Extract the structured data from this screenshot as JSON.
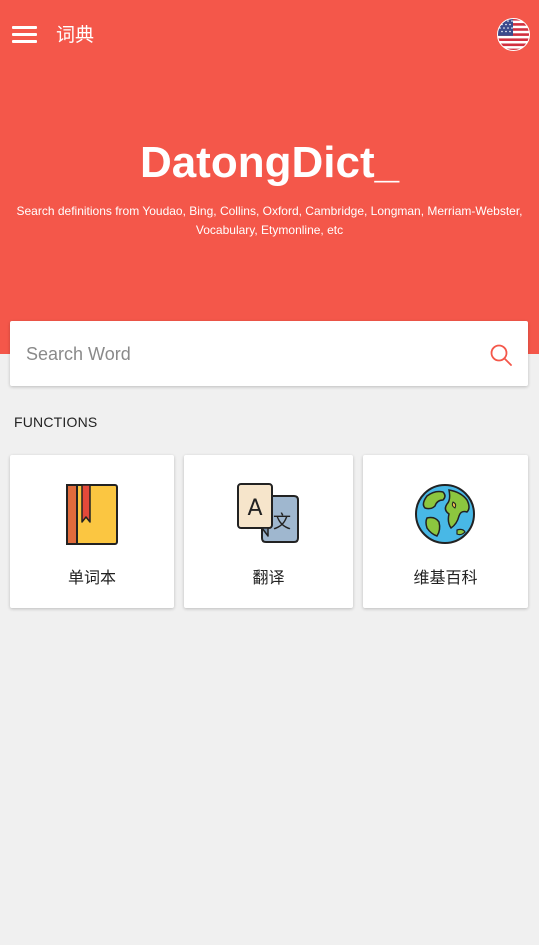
{
  "header": {
    "app_title": "词典",
    "menu_icon": "hamburger-menu-icon",
    "language_flag_icon": "us-flag-icon"
  },
  "hero": {
    "brand": "DatongDict_",
    "tagline_line1": "Search definitions from Youdao, Bing, Collins, Oxford, Cambridge, Longman, Merriam-Webster,",
    "tagline_line2": "Vocabulary, Etymonline, etc",
    "background_color": "#f4574a"
  },
  "search": {
    "placeholder": "Search Word",
    "value": "",
    "icon": "search-icon",
    "icon_color": "#f4574a"
  },
  "functions": {
    "title": "FUNCTIONS",
    "items": [
      {
        "label": "单词本",
        "icon": "notebook-icon"
      },
      {
        "label": "翻译",
        "icon": "translate-icon"
      },
      {
        "label": "维基百科",
        "icon": "globe-icon"
      }
    ]
  }
}
